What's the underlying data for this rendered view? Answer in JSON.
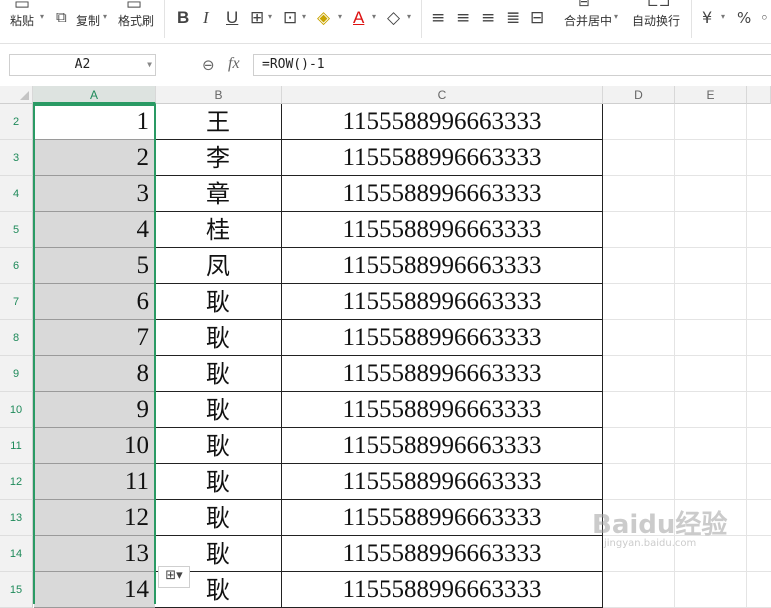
{
  "toolbar": {
    "paste_label": "粘贴",
    "copy_label": "复制",
    "format_painter_label": "格式刷",
    "bold": "B",
    "italic": "I",
    "underline": "U",
    "font_color_glyph": "A",
    "merge_center_label": "合并居中",
    "wrap_text_label": "自动换行",
    "currency_glyph": "¥",
    "percent_glyph": "%"
  },
  "formula_bar": {
    "name_box": "A2",
    "fx_label": "fx",
    "formula": "=ROW()-1"
  },
  "columns": [
    "A",
    "B",
    "C",
    "D",
    "E"
  ],
  "rows": [
    {
      "num": "2",
      "a": "1",
      "b": "王",
      "c": "1155588996663333"
    },
    {
      "num": "3",
      "a": "2",
      "b": "李",
      "c": "1155588996663333"
    },
    {
      "num": "4",
      "a": "3",
      "b": "章",
      "c": "1155588996663333"
    },
    {
      "num": "5",
      "a": "4",
      "b": "桂",
      "c": "1155588996663333"
    },
    {
      "num": "6",
      "a": "5",
      "b": "凤",
      "c": "1155588996663333"
    },
    {
      "num": "7",
      "a": "6",
      "b": "耿",
      "c": "1155588996663333"
    },
    {
      "num": "8",
      "a": "7",
      "b": "耿",
      "c": "1155588996663333"
    },
    {
      "num": "9",
      "a": "8",
      "b": "耿",
      "c": "1155588996663333"
    },
    {
      "num": "10",
      "a": "9",
      "b": "耿",
      "c": "1155588996663333"
    },
    {
      "num": "11",
      "a": "10",
      "b": "耿",
      "c": "1155588996663333"
    },
    {
      "num": "12",
      "a": "11",
      "b": "耿",
      "c": "1155588996663333"
    },
    {
      "num": "13",
      "a": "12",
      "b": "耿",
      "c": "1155588996663333"
    },
    {
      "num": "14",
      "a": "13",
      "b": "耿",
      "c": "1155588996663333"
    },
    {
      "num": "15",
      "a": "14",
      "b": "耿",
      "c": "1155588996663333"
    }
  ],
  "watermark": {
    "brand": "Baidu经验",
    "url": "jingyan.baidu.com"
  },
  "colors": {
    "selection_green": "#2a9a64",
    "selected_fill": "#d9d9d9"
  }
}
